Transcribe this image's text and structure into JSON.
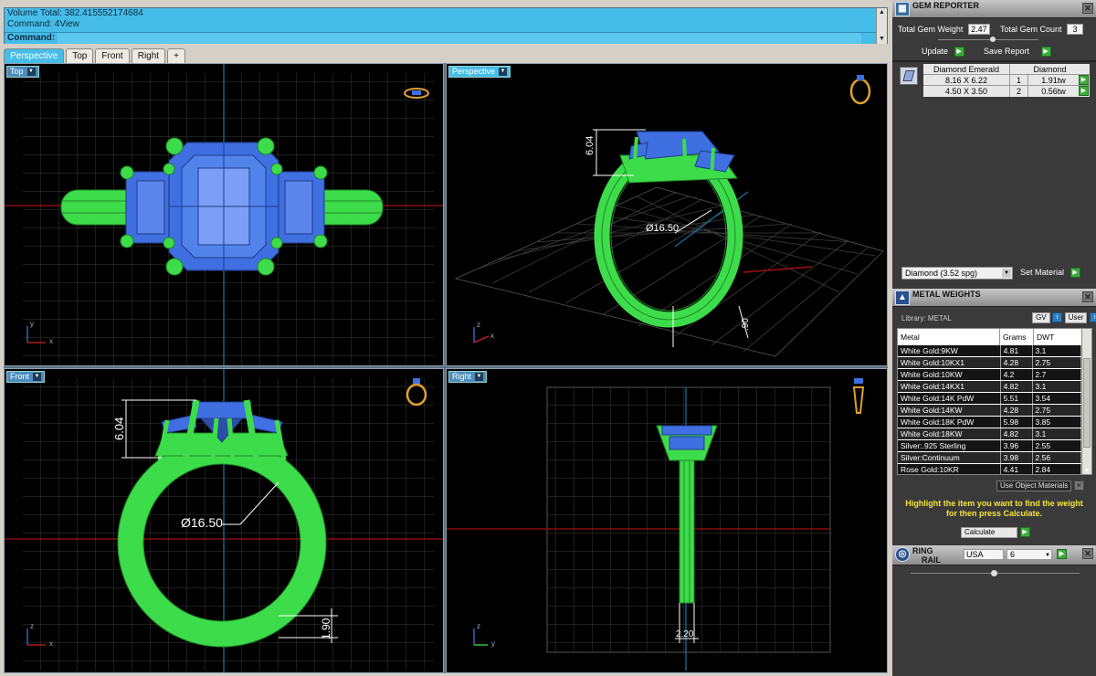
{
  "command": {
    "line1": "Volume Total: 382.415552174684",
    "line2": "Command: 4View",
    "prompt_label": "Command:",
    "input_value": ""
  },
  "tabs": [
    {
      "label": "Perspective",
      "active": true
    },
    {
      "label": "Top"
    },
    {
      "label": "Front"
    },
    {
      "label": "Right"
    },
    {
      "label": "+"
    }
  ],
  "viewports": {
    "top": {
      "label": "Top"
    },
    "perspective": {
      "label": "Perspective"
    },
    "front": {
      "label": "Front"
    },
    "right": {
      "label": "Right"
    }
  },
  "dimensions": {
    "height": "6.04",
    "diameter": "Ø16.50",
    "band_thickness": "1.90",
    "band_width": "2.20",
    "persp_small": ".90"
  },
  "axes": {
    "x": "x",
    "y": "y",
    "z": "z"
  },
  "gem_reporter": {
    "title": "GEM REPORTER",
    "total_weight_label": "Total Gem Weight",
    "total_weight_value": "2.47",
    "total_count_label": "Total Gem Count",
    "total_count_value": "3",
    "update_label": "Update",
    "save_report_label": "Save Report",
    "gem_cut": "Diamond Emerald",
    "gem_material": "Diamond",
    "rows": [
      {
        "size": "8.16 X 6.22",
        "count": "1",
        "weight": "1.91tw"
      },
      {
        "size": "4.50 X 3.50",
        "count": "2",
        "weight": "0.56tw"
      }
    ],
    "material_value": "Diamond      (3.52 spg)",
    "set_material_label": "Set Material"
  },
  "metal_weights": {
    "title": "METAL WEIGHTS",
    "library_label": "Library: METAL",
    "gv_label": "GV",
    "user_label": "User",
    "columns": [
      "Metal",
      "Grams",
      "DWT"
    ],
    "rows": [
      [
        "White Gold:9KW",
        "4.81",
        "3.1"
      ],
      [
        "White Gold:10KX1",
        "4.28",
        "2.75"
      ],
      [
        "White Gold:10KW",
        "4.2",
        "2.7"
      ],
      [
        "White Gold:14KX1",
        "4.82",
        "3.1"
      ],
      [
        "White Gold:14K PdW",
        "5.51",
        "3.54"
      ],
      [
        "White Gold:14KW",
        "4.28",
        "2.75"
      ],
      [
        "White Gold:18K PdW",
        "5.98",
        "3.85"
      ],
      [
        "White Gold:18KW",
        "4.82",
        "3.1"
      ],
      [
        "Silver:.925 Sterling",
        "3.96",
        "2.55"
      ],
      [
        "Silver:Continuum",
        "3.98",
        "2.56"
      ],
      [
        "Rose Gold:10KR",
        "4.41",
        "2.84"
      ]
    ],
    "use_object_label": "Use Object Materials",
    "hint_line1": "Highlight the item you want to find the weight",
    "hint_line2": "for then press Calculate.",
    "calculate_label": "Calculate"
  },
  "ring_rail": {
    "title_line1": "RING",
    "title_line2": "RAIL",
    "region": "USA",
    "size": "6"
  },
  "colors": {
    "command_bg": "#46bde8",
    "grid_major": "#4a4a4a",
    "metal": "#3ddc4a",
    "gem": "#3f6fe0",
    "panel_bg": "#3a3a3a",
    "hint": "#f3e43a"
  }
}
